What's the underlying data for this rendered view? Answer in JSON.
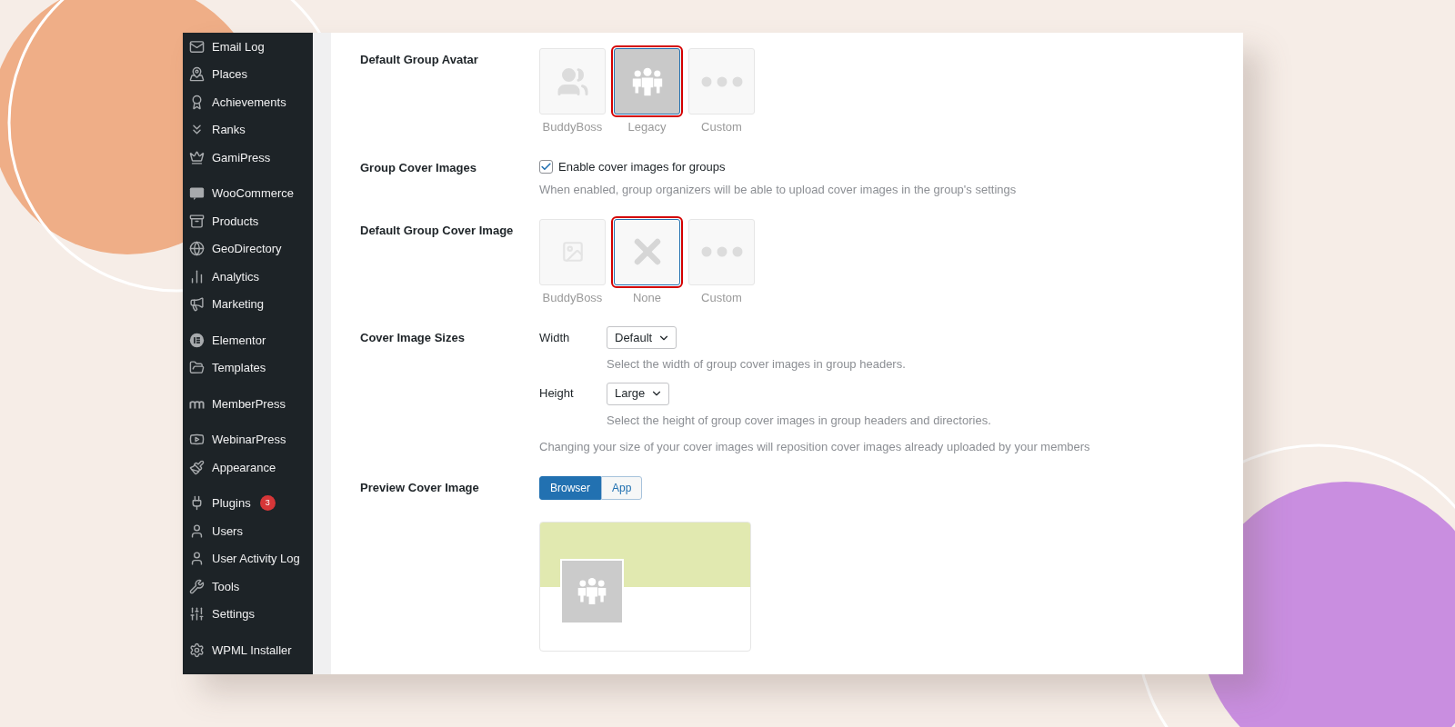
{
  "sidebar": {
    "groups": [
      [
        {
          "label": "Email Log"
        },
        {
          "label": "Places"
        },
        {
          "label": "Achievements"
        },
        {
          "label": "Ranks"
        },
        {
          "label": "GamiPress"
        }
      ],
      [
        {
          "label": "WooCommerce"
        },
        {
          "label": "Products"
        },
        {
          "label": "GeoDirectory"
        },
        {
          "label": "Analytics"
        },
        {
          "label": "Marketing"
        }
      ],
      [
        {
          "label": "Elementor"
        },
        {
          "label": "Templates"
        }
      ],
      [
        {
          "label": "MemberPress"
        }
      ],
      [
        {
          "label": "WebinarPress"
        },
        {
          "label": "Appearance"
        }
      ],
      [
        {
          "label": "Plugins",
          "badge": "3"
        },
        {
          "label": "Users"
        },
        {
          "label": "User Activity Log"
        },
        {
          "label": "Tools"
        },
        {
          "label": "Settings"
        }
      ],
      [
        {
          "label": "WPML Installer"
        }
      ]
    ]
  },
  "settings": [
    {
      "kind": "tiles",
      "label": "Default Group Avatar",
      "options": [
        {
          "kind": "people",
          "label": "BuddyBoss",
          "selected": false
        },
        {
          "kind": "group",
          "label": "Legacy",
          "selected": true
        },
        {
          "kind": "dots",
          "label": "Custom",
          "selected": false
        }
      ]
    },
    {
      "kind": "checkbox",
      "label": "Group Cover Images",
      "checkbox": {
        "label": "Enable cover images for groups",
        "checked": true
      },
      "description": "When enabled, group organizers will be able to upload cover images in the group's settings"
    },
    {
      "kind": "tiles",
      "label": "Default Group Cover Image",
      "options": [
        {
          "kind": "pattern",
          "label": "BuddyBoss",
          "selected": false
        },
        {
          "kind": "cross",
          "label": "None",
          "selected": true
        },
        {
          "kind": "dots",
          "label": "Custom",
          "selected": false
        }
      ]
    },
    {
      "kind": "sizes",
      "label": "Cover Image Sizes",
      "fields": [
        {
          "label": "Width",
          "value": "Default",
          "description": "Select the width of group cover images in group headers."
        },
        {
          "label": "Height",
          "value": "Large",
          "description": "Select the height of group cover images in group headers and directories."
        }
      ],
      "note": "Changing your size of your cover images will reposition cover images already uploaded by your members"
    },
    {
      "kind": "preview",
      "label": "Preview Cover Image",
      "tabs": [
        {
          "label": "Browser",
          "selected": true
        },
        {
          "label": "App",
          "selected": false
        }
      ]
    }
  ]
}
